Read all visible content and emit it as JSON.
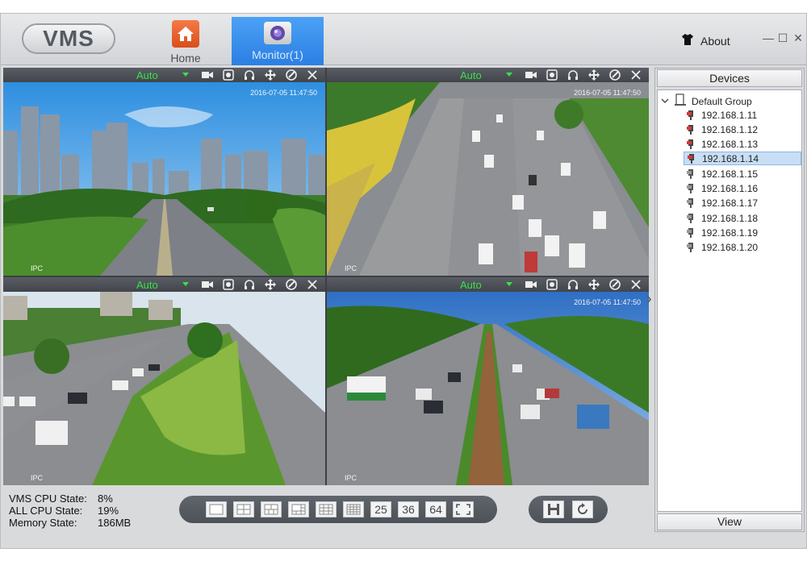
{
  "app": {
    "logo": "VMS"
  },
  "tabs": [
    {
      "label": "Home",
      "icon": "home-icon"
    },
    {
      "label": "Monitor(1)",
      "icon": "camera-icon"
    }
  ],
  "header": {
    "about_label": "About",
    "minimize": "—",
    "restore": "☐",
    "close": "✕"
  },
  "cells": [
    {
      "stream": "Auto",
      "timestamp": "2016-07-05 11:47:50",
      "source": "IPC"
    },
    {
      "stream": "Auto",
      "timestamp": "2016-07-05 11:47:50",
      "source": "IPC"
    },
    {
      "stream": "Auto",
      "timestamp": "",
      "source": "IPC"
    },
    {
      "stream": "Auto",
      "timestamp": "2016-07-05 11:47:50",
      "source": "IPC"
    }
  ],
  "devices": {
    "header": "Devices",
    "group": "Default Group",
    "items": [
      "192.168.1.11",
      "192.168.1.12",
      "192.168.1.13",
      "192.168.1.14",
      "192.168.1.15",
      "192.168.1.16",
      "192.168.1.17",
      "192.168.1.18",
      "192.168.1.19",
      "192.168.1.20"
    ],
    "selected": "192.168.1.14",
    "view_label": "View"
  },
  "status": {
    "vms_cpu_label": "VMS CPU State:",
    "vms_cpu_value": "8%",
    "all_cpu_label": "ALL CPU State:",
    "all_cpu_value": "19%",
    "memory_label": "Memory State:",
    "memory_value": "186MB"
  },
  "layouts": {
    "l25": "25",
    "l36": "36",
    "l64": "64"
  },
  "colors": {
    "accent": "#2b7fe3",
    "stream_green": "#37e24a",
    "home_orange": "#e85d26"
  }
}
